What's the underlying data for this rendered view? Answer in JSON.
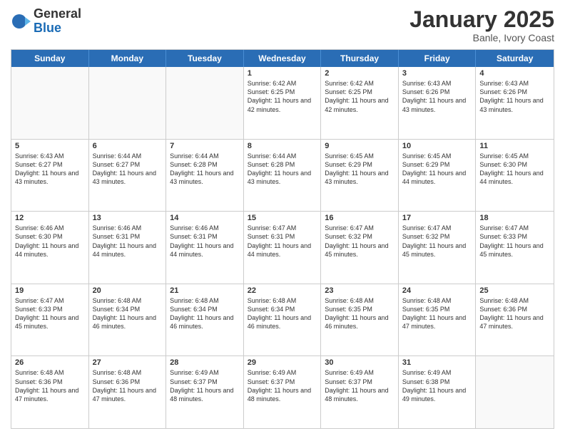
{
  "logo": {
    "general": "General",
    "blue": "Blue"
  },
  "header": {
    "month": "January 2025",
    "location": "Banle, Ivory Coast"
  },
  "weekdays": [
    "Sunday",
    "Monday",
    "Tuesday",
    "Wednesday",
    "Thursday",
    "Friday",
    "Saturday"
  ],
  "weeks": [
    [
      {
        "day": "",
        "info": ""
      },
      {
        "day": "",
        "info": ""
      },
      {
        "day": "",
        "info": ""
      },
      {
        "day": "1",
        "info": "Sunrise: 6:42 AM\nSunset: 6:25 PM\nDaylight: 11 hours\nand 42 minutes."
      },
      {
        "day": "2",
        "info": "Sunrise: 6:42 AM\nSunset: 6:25 PM\nDaylight: 11 hours\nand 42 minutes."
      },
      {
        "day": "3",
        "info": "Sunrise: 6:43 AM\nSunset: 6:26 PM\nDaylight: 11 hours\nand 43 minutes."
      },
      {
        "day": "4",
        "info": "Sunrise: 6:43 AM\nSunset: 6:26 PM\nDaylight: 11 hours\nand 43 minutes."
      }
    ],
    [
      {
        "day": "5",
        "info": "Sunrise: 6:43 AM\nSunset: 6:27 PM\nDaylight: 11 hours\nand 43 minutes."
      },
      {
        "day": "6",
        "info": "Sunrise: 6:44 AM\nSunset: 6:27 PM\nDaylight: 11 hours\nand 43 minutes."
      },
      {
        "day": "7",
        "info": "Sunrise: 6:44 AM\nSunset: 6:28 PM\nDaylight: 11 hours\nand 43 minutes."
      },
      {
        "day": "8",
        "info": "Sunrise: 6:44 AM\nSunset: 6:28 PM\nDaylight: 11 hours\nand 43 minutes."
      },
      {
        "day": "9",
        "info": "Sunrise: 6:45 AM\nSunset: 6:29 PM\nDaylight: 11 hours\nand 43 minutes."
      },
      {
        "day": "10",
        "info": "Sunrise: 6:45 AM\nSunset: 6:29 PM\nDaylight: 11 hours\nand 44 minutes."
      },
      {
        "day": "11",
        "info": "Sunrise: 6:45 AM\nSunset: 6:30 PM\nDaylight: 11 hours\nand 44 minutes."
      }
    ],
    [
      {
        "day": "12",
        "info": "Sunrise: 6:46 AM\nSunset: 6:30 PM\nDaylight: 11 hours\nand 44 minutes."
      },
      {
        "day": "13",
        "info": "Sunrise: 6:46 AM\nSunset: 6:31 PM\nDaylight: 11 hours\nand 44 minutes."
      },
      {
        "day": "14",
        "info": "Sunrise: 6:46 AM\nSunset: 6:31 PM\nDaylight: 11 hours\nand 44 minutes."
      },
      {
        "day": "15",
        "info": "Sunrise: 6:47 AM\nSunset: 6:31 PM\nDaylight: 11 hours\nand 44 minutes."
      },
      {
        "day": "16",
        "info": "Sunrise: 6:47 AM\nSunset: 6:32 PM\nDaylight: 11 hours\nand 45 minutes."
      },
      {
        "day": "17",
        "info": "Sunrise: 6:47 AM\nSunset: 6:32 PM\nDaylight: 11 hours\nand 45 minutes."
      },
      {
        "day": "18",
        "info": "Sunrise: 6:47 AM\nSunset: 6:33 PM\nDaylight: 11 hours\nand 45 minutes."
      }
    ],
    [
      {
        "day": "19",
        "info": "Sunrise: 6:47 AM\nSunset: 6:33 PM\nDaylight: 11 hours\nand 45 minutes."
      },
      {
        "day": "20",
        "info": "Sunrise: 6:48 AM\nSunset: 6:34 PM\nDaylight: 11 hours\nand 46 minutes."
      },
      {
        "day": "21",
        "info": "Sunrise: 6:48 AM\nSunset: 6:34 PM\nDaylight: 11 hours\nand 46 minutes."
      },
      {
        "day": "22",
        "info": "Sunrise: 6:48 AM\nSunset: 6:34 PM\nDaylight: 11 hours\nand 46 minutes."
      },
      {
        "day": "23",
        "info": "Sunrise: 6:48 AM\nSunset: 6:35 PM\nDaylight: 11 hours\nand 46 minutes."
      },
      {
        "day": "24",
        "info": "Sunrise: 6:48 AM\nSunset: 6:35 PM\nDaylight: 11 hours\nand 47 minutes."
      },
      {
        "day": "25",
        "info": "Sunrise: 6:48 AM\nSunset: 6:36 PM\nDaylight: 11 hours\nand 47 minutes."
      }
    ],
    [
      {
        "day": "26",
        "info": "Sunrise: 6:48 AM\nSunset: 6:36 PM\nDaylight: 11 hours\nand 47 minutes."
      },
      {
        "day": "27",
        "info": "Sunrise: 6:48 AM\nSunset: 6:36 PM\nDaylight: 11 hours\nand 47 minutes."
      },
      {
        "day": "28",
        "info": "Sunrise: 6:49 AM\nSunset: 6:37 PM\nDaylight: 11 hours\nand 48 minutes."
      },
      {
        "day": "29",
        "info": "Sunrise: 6:49 AM\nSunset: 6:37 PM\nDaylight: 11 hours\nand 48 minutes."
      },
      {
        "day": "30",
        "info": "Sunrise: 6:49 AM\nSunset: 6:37 PM\nDaylight: 11 hours\nand 48 minutes."
      },
      {
        "day": "31",
        "info": "Sunrise: 6:49 AM\nSunset: 6:38 PM\nDaylight: 11 hours\nand 49 minutes."
      },
      {
        "day": "",
        "info": ""
      }
    ]
  ]
}
